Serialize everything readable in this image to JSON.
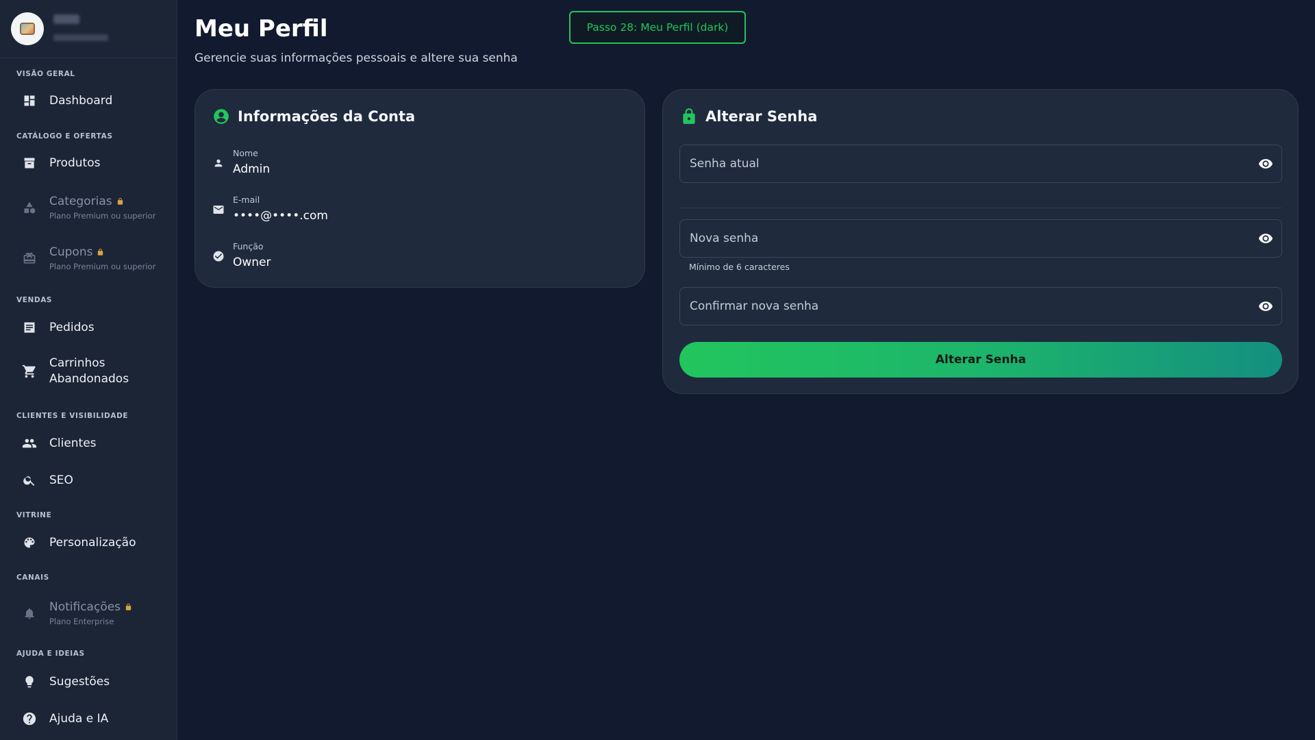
{
  "header": {
    "title": "Meu Perfil",
    "subtitle": "Gerencie suas informações pessoais e altere sua senha",
    "step_badge": "Passo 28: Meu Perfil (dark)"
  },
  "sidebar": {
    "sections": [
      {
        "label": "VISÃO GERAL"
      },
      {
        "label": "CATÁLOGO E OFERTAS"
      },
      {
        "label": "VENDAS"
      },
      {
        "label": "CLIENTES E VISIBILIDADE"
      },
      {
        "label": "VITRINE"
      },
      {
        "label": "CANAIS"
      },
      {
        "label": "AJUDA E IDEIAS"
      }
    ],
    "items": [
      {
        "label": "Dashboard",
        "icon": "dashboard-icon"
      },
      {
        "label": "Produtos",
        "icon": "archive-icon"
      },
      {
        "label": "Categorias",
        "sub": "Plano Premium ou superior",
        "icon": "category-icon",
        "locked": true
      },
      {
        "label": "Cupons",
        "sub": "Plano Premium ou superior",
        "icon": "coupon-icon",
        "locked": true
      },
      {
        "label": "Pedidos",
        "icon": "receipt-icon"
      },
      {
        "label": "Carrinhos",
        "label2": "Abandonados",
        "icon": "cart-icon"
      },
      {
        "label": "Clientes",
        "icon": "people-icon"
      },
      {
        "label": "SEO",
        "icon": "search-icon"
      },
      {
        "label": "Personalização",
        "icon": "palette-icon"
      },
      {
        "label": "Notificações",
        "sub": "Plano Enterprise",
        "icon": "bell-icon",
        "locked": true
      },
      {
        "label": "Sugestões",
        "icon": "lightbulb-icon"
      },
      {
        "label": "Ajuda e IA",
        "icon": "help-icon"
      }
    ]
  },
  "account_card": {
    "title": "Informações da Conta",
    "rows": [
      {
        "key": "Nome",
        "value": "Admin"
      },
      {
        "key": "E-mail",
        "value": "••••@••••.com"
      },
      {
        "key": "Função",
        "value": "Owner"
      }
    ]
  },
  "password_card": {
    "title": "Alterar Senha",
    "current_placeholder": "Senha atual",
    "new_placeholder": "Nova senha",
    "new_hint": "Mínimo de 6 caracteres",
    "confirm_placeholder": "Confirmar nova senha",
    "submit_label": "Alterar Senha"
  },
  "colors": {
    "background": "#111a2e",
    "sidebar": "#1c2536",
    "card": "#1f2a3d",
    "accent": "#22c55e",
    "lock": "#d9a441"
  }
}
